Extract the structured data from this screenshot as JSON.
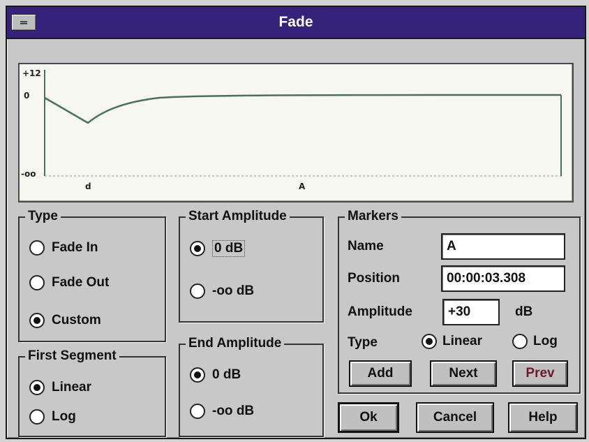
{
  "window": {
    "title": "Fade",
    "system_menu_glyph": "═",
    "title_bar_color": "#35227a"
  },
  "graph": {
    "y_top_label": "+12",
    "y_zero_label": "0",
    "y_bottom_label": "-oo",
    "markers": [
      {
        "label": "d"
      },
      {
        "label": "A"
      }
    ],
    "curve_color": "#4a6f5c"
  },
  "type_group": {
    "legend": "Type",
    "options": [
      {
        "label": "Fade In",
        "selected": false
      },
      {
        "label": "Fade Out",
        "selected": false
      },
      {
        "label": "Custom",
        "selected": true
      }
    ]
  },
  "first_segment_group": {
    "legend": "First Segment",
    "options": [
      {
        "label": "Linear",
        "selected": true
      },
      {
        "label": "Log",
        "selected": false
      }
    ]
  },
  "start_amplitude_group": {
    "legend": "Start Amplitude",
    "options": [
      {
        "label": "0 dB",
        "selected": true
      },
      {
        "label": "-oo dB",
        "selected": false
      }
    ]
  },
  "end_amplitude_group": {
    "legend": "End Amplitude",
    "options": [
      {
        "label": "0 dB",
        "selected": true
      },
      {
        "label": "-oo dB",
        "selected": false
      }
    ]
  },
  "markers_group": {
    "legend": "Markers",
    "name_label": "Name",
    "name_value": "A",
    "position_label": "Position",
    "position_value": "00:00:03.308",
    "amplitude_label": "Amplitude",
    "amplitude_value": "+30",
    "amplitude_unit": "dB",
    "type_label": "Type",
    "type_options": [
      {
        "label": "Linear",
        "selected": true
      },
      {
        "label": "Log",
        "selected": false
      }
    ],
    "add_button": "Add",
    "next_button": "Next",
    "prev_button": "Prev"
  },
  "buttons": {
    "ok": "Ok",
    "cancel": "Cancel",
    "help": "Help"
  }
}
